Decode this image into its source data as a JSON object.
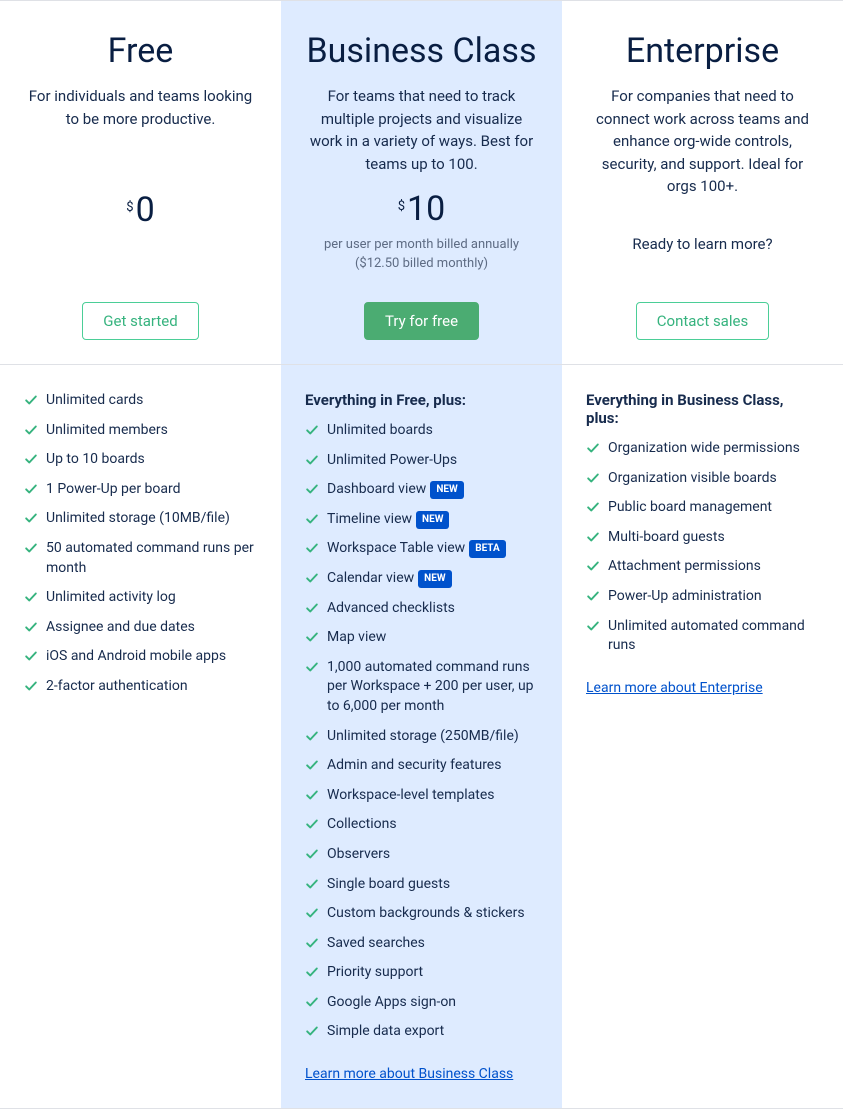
{
  "plans": [
    {
      "title": "Free",
      "desc": "For individuals and teams looking to be more productive.",
      "price": "0",
      "price_note": "",
      "ready_text": "",
      "cta": "Get started",
      "cta_style": "outline",
      "features_heading": "",
      "features": [
        {
          "text": "Unlimited cards"
        },
        {
          "text": "Unlimited members"
        },
        {
          "text": "Up to 10 boards"
        },
        {
          "text": "1 Power-Up per board"
        },
        {
          "text": "Unlimited storage (10MB/file)"
        },
        {
          "text": "50 automated command runs per month"
        },
        {
          "text": "Unlimited activity log"
        },
        {
          "text": "Assignee and due dates"
        },
        {
          "text": "iOS and Android mobile apps"
        },
        {
          "text": "2-factor authentication"
        }
      ],
      "learn_more": ""
    },
    {
      "title": "Business Class",
      "desc": "For teams that need to track multiple projects and visualize work in a variety of ways. Best for teams up to 100.",
      "price": "10",
      "price_note": "per user per month billed annually ($12.50 billed monthly)",
      "ready_text": "",
      "cta": "Try for free",
      "cta_style": "solid",
      "features_heading": "Everything in Free, plus:",
      "features": [
        {
          "text": "Unlimited boards"
        },
        {
          "text": "Unlimited Power-Ups"
        },
        {
          "text": "Dashboard view",
          "badge": "NEW"
        },
        {
          "text": "Timeline view",
          "badge": "NEW"
        },
        {
          "text": "Workspace Table view",
          "badge": "BETA"
        },
        {
          "text": "Calendar view",
          "badge": "NEW"
        },
        {
          "text": "Advanced checklists"
        },
        {
          "text": "Map view"
        },
        {
          "text": "1,000 automated command runs per Workspace + 200 per user, up to 6,000 per month"
        },
        {
          "text": "Unlimited storage (250MB/file)"
        },
        {
          "text": "Admin and security features"
        },
        {
          "text": "Workspace-level templates"
        },
        {
          "text": "Collections"
        },
        {
          "text": "Observers"
        },
        {
          "text": "Single board guests"
        },
        {
          "text": "Custom backgrounds & stickers"
        },
        {
          "text": "Saved searches"
        },
        {
          "text": "Priority support"
        },
        {
          "text": "Google Apps sign-on"
        },
        {
          "text": "Simple data export"
        }
      ],
      "learn_more": "Learn more about Business Class"
    },
    {
      "title": "Enterprise",
      "desc": "For companies that need to connect work across teams and enhance org-wide controls, security, and support. Ideal for orgs 100+.",
      "price": "",
      "price_note": "",
      "ready_text": "Ready to learn more?",
      "cta": "Contact sales",
      "cta_style": "outline",
      "features_heading": "Everything in Business Class, plus:",
      "features": [
        {
          "text": "Organization wide permissions"
        },
        {
          "text": "Organization visible boards"
        },
        {
          "text": "Public board management"
        },
        {
          "text": "Multi-board guests"
        },
        {
          "text": "Attachment permissions"
        },
        {
          "text": "Power-Up administration"
        },
        {
          "text": "Unlimited automated command runs"
        }
      ],
      "learn_more": "Learn more about Enterprise"
    }
  ]
}
